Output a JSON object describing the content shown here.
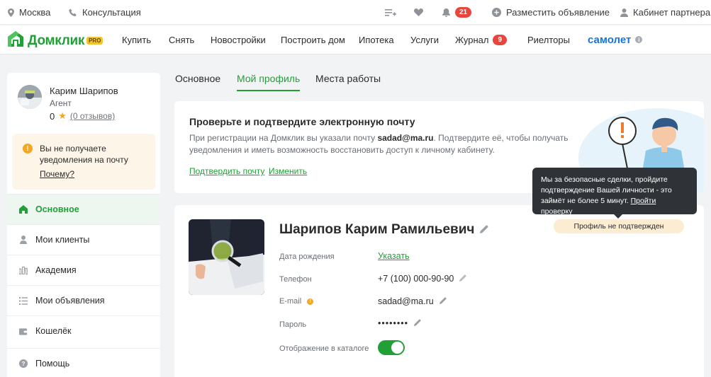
{
  "topbar": {
    "city": "Москва",
    "consult": "Консультация",
    "notifications_count": "21",
    "post_ad": "Разместить объявление",
    "partner_cabinet": "Кабинет партнера"
  },
  "nav": {
    "logo": "Домклик",
    "logo_badge": "PRO",
    "items": [
      "Купить",
      "Снять",
      "Новостройки",
      "Построить дом",
      "Ипотека",
      "Услуги",
      "Журнал",
      "Риелторы"
    ],
    "journal_badge": "9",
    "partner": "самолет"
  },
  "sidebar": {
    "user_name": "Карим Шарипов",
    "user_role": "Агент",
    "rating": "0",
    "reviews": "(0 отзывов)",
    "warning_text": "Вы не получаете уведомления на почту",
    "warning_link": "Почему?",
    "items": [
      {
        "label": "Основное",
        "icon": "home-icon"
      },
      {
        "label": "Мои клиенты",
        "icon": "person-icon"
      },
      {
        "label": "Академия",
        "icon": "academy-icon"
      },
      {
        "label": "Мои объявления",
        "icon": "list-icon"
      },
      {
        "label": "Кошелёк",
        "icon": "wallet-icon"
      },
      {
        "label": "Помощь",
        "icon": "help-icon"
      }
    ]
  },
  "tabs": [
    "Основное",
    "Мой профиль",
    "Места работы"
  ],
  "email_card": {
    "title": "Проверьте и подтвердите электронную почту",
    "desc_before": "При регистрации на Домклик вы указали почту ",
    "email": "sadad@ma.ru",
    "desc_after": ". Подтвердите её, чтобы получать уведомления и иметь возможность восстановить доступ к личному кабинету.",
    "confirm": "Подтвердить почту",
    "change": "Изменить"
  },
  "tooltip": {
    "text": "Мы за безопасные сделки, пройдите подтверждение Вашей личности - это займёт не более 5 минут.",
    "link": "Пройти проверку"
  },
  "profile": {
    "full_name": "Шарипов Карим Рамильевич",
    "status": "Профиль не подтвержден",
    "birth_label": "Дата рождения",
    "birth_value": "Указать",
    "phone_label": "Телефон",
    "phone_value": "+7 (100) 000-90-90",
    "email_label": "E-mail",
    "email_value": "sadad@ma.ru",
    "password_label": "Пароль",
    "password_value": "••••••••",
    "catalog_label": "Отображение в каталоге",
    "catalog_enabled": true
  },
  "colors": {
    "brand": "#21a038",
    "badge": "#e8453c",
    "warning": "#f5a623",
    "samolet": "#1a73d9"
  }
}
